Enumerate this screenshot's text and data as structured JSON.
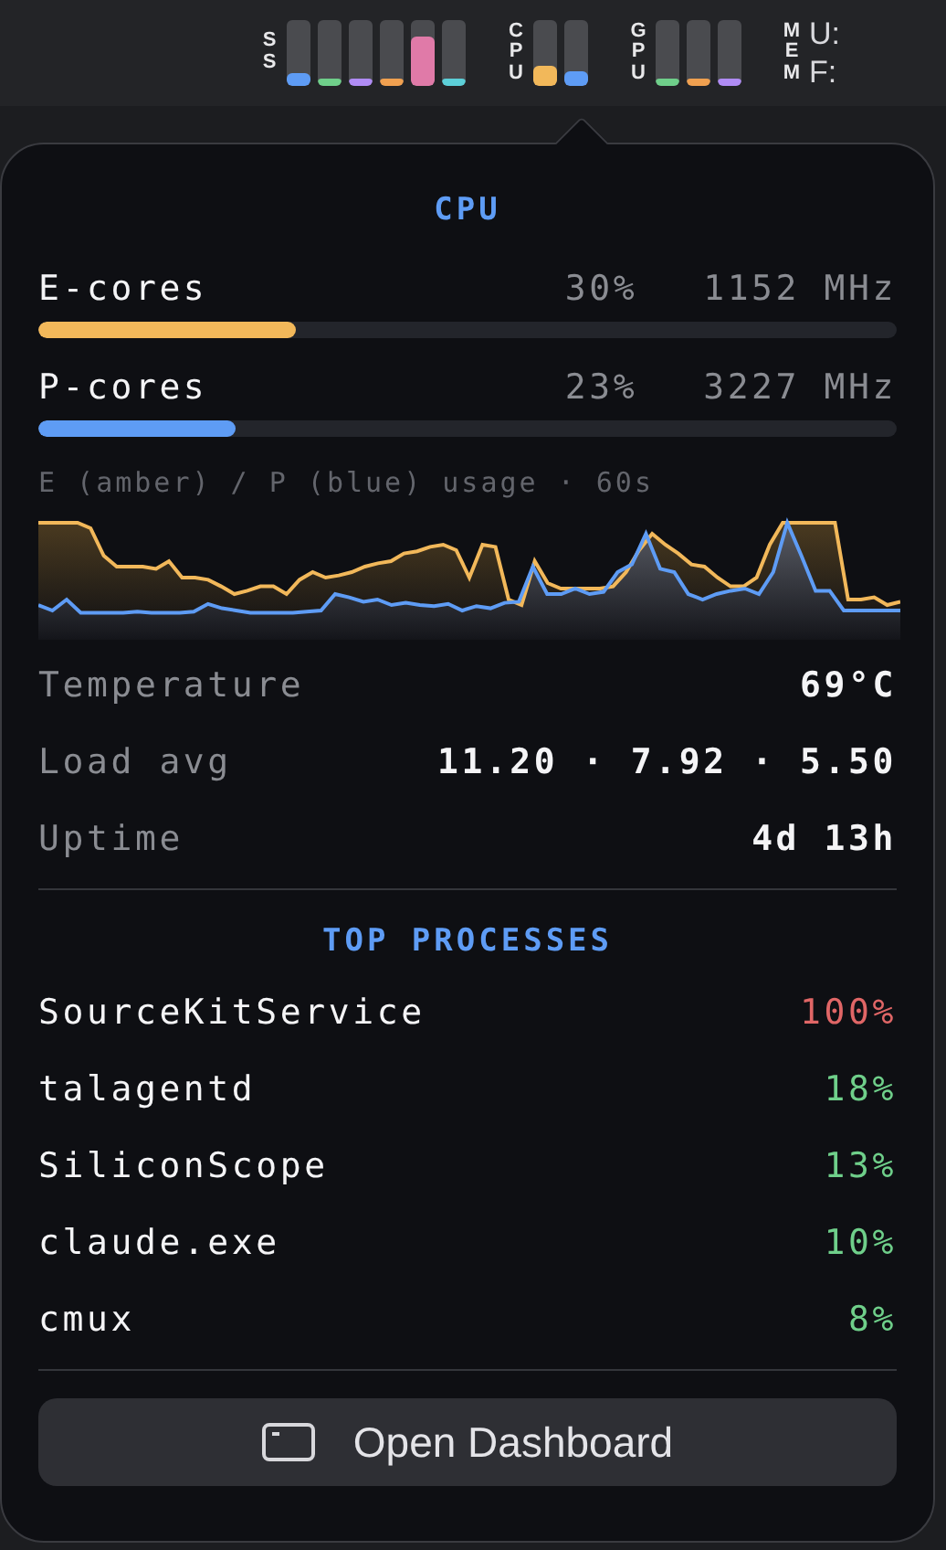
{
  "menu_bar": {
    "groups": [
      {
        "label": "SS",
        "bars": [
          {
            "level": 0.2,
            "color": "#5e9cf5"
          },
          {
            "level": 0.1,
            "color": "#6fcf8a"
          },
          {
            "level": 0.1,
            "color": "#b08cf5"
          },
          {
            "level": 0.1,
            "color": "#f0a050"
          },
          {
            "level": 0.75,
            "color": "#e07aa8"
          },
          {
            "level": 0.1,
            "color": "#5ccfd8"
          }
        ]
      },
      {
        "label": "CPU",
        "bars": [
          {
            "level": 0.3,
            "color": "#f2b85a"
          },
          {
            "level": 0.23,
            "color": "#5e9cf5"
          }
        ]
      },
      {
        "label": "GPU",
        "bars": [
          {
            "level": 0.1,
            "color": "#6fcf8a"
          },
          {
            "level": 0.1,
            "color": "#f0a050"
          },
          {
            "level": 0.1,
            "color": "#b08cf5"
          }
        ]
      }
    ],
    "memory": {
      "label": "MEM",
      "lines": [
        "U:",
        "F:"
      ]
    }
  },
  "cpu": {
    "title": "CPU",
    "cores": [
      {
        "name": "E-cores",
        "usage": "30%",
        "frequency": "1152 MHz",
        "level": 0.3,
        "color": "#f2b85a"
      },
      {
        "name": "P-cores",
        "usage": "23%",
        "frequency": "3227 MHz",
        "level": 0.23,
        "color": "#5e9cf5"
      }
    ],
    "chart_caption": "E (amber) / P (blue) usage · 60s",
    "stats": [
      {
        "label": "Temperature",
        "value": "69°C"
      },
      {
        "label": "Load avg",
        "value": "11.20 · 7.92 · 5.50"
      },
      {
        "label": "Uptime",
        "value": "4d 13h"
      }
    ]
  },
  "top_processes": {
    "title": "TOP PROCESSES",
    "rows": [
      {
        "name": "SourceKitService",
        "usage": "100%",
        "color": "#e06666"
      },
      {
        "name": "talagentd",
        "usage": "18%",
        "color": "#6fcf8a"
      },
      {
        "name": "SiliconScope",
        "usage": "13%",
        "color": "#6fcf8a"
      },
      {
        "name": "claude.exe",
        "usage": "10%",
        "color": "#6fcf8a"
      },
      {
        "name": "cmux",
        "usage": "8%",
        "color": "#6fcf8a"
      }
    ]
  },
  "button": {
    "label": "Open Dashboard"
  }
}
